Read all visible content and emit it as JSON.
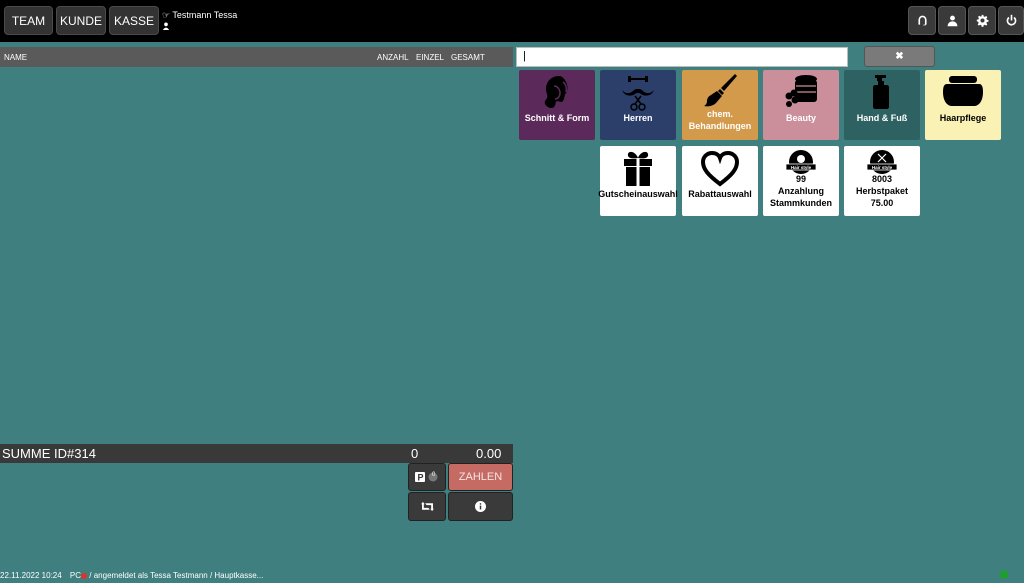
{
  "nav": {
    "team": "TEAM",
    "kunde": "KUNDE",
    "kasse": "KASSE"
  },
  "user": {
    "name": "Testmann Tessa"
  },
  "table": {
    "col_name": "NAME",
    "col_anzahl": "ANZAHL",
    "col_einzel": "EINZEL",
    "col_gesamt": "GESAMT"
  },
  "summary": {
    "label": "SUMME ID#314",
    "count": "0",
    "total": "0.00"
  },
  "actions": {
    "pay": "ZAHLEN",
    "park_badge": "0"
  },
  "search": {
    "value": "|"
  },
  "clear_label": "✖",
  "categories": [
    {
      "label": "Schnitt & Form",
      "color": "#5b2a5b"
    },
    {
      "label": "Herren",
      "color": "#2c3f6a"
    },
    {
      "label": "chem. Behandlungen",
      "color": "#d29a4a"
    },
    {
      "label": "Beauty",
      "color": "#cb8e9b"
    },
    {
      "label": "Hand & Fuß",
      "color": "#2e6262"
    },
    {
      "label": "Haarpflege",
      "color": "#faf2b5"
    }
  ],
  "tiles2": [
    {
      "label": "Gutscheinauswahl"
    },
    {
      "label": "Rabattauswahl"
    },
    {
      "label": "Anzahlung Stammkunden",
      "code": "99",
      "badge": "Hair style"
    },
    {
      "label": "Herbstpaket",
      "code": "8003",
      "price": "75.00",
      "badge": "Hair style"
    }
  ],
  "status": {
    "datetime": "22.11.2022 10:24",
    "pc": "PC",
    "text": "/ angemeldet als Tessa Testmann / Hauptkasse..."
  }
}
